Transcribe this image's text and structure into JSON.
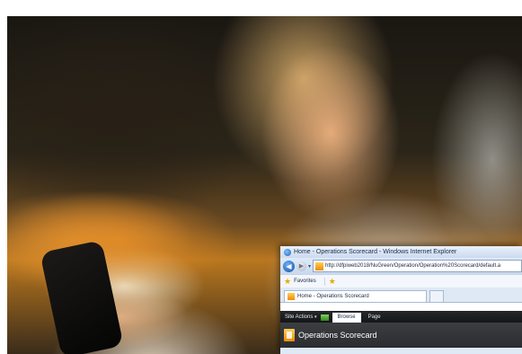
{
  "ie": {
    "window_title": "Home - Operations Scorecard - Windows Internet Explorer",
    "address_url": "http://dfpiweb2018/NuGreen/Operation/Operation%20Scorecard/default.a",
    "favorites_label": "Favorites",
    "tab_title": "Home - Operations Scorecard"
  },
  "sharepoint": {
    "site_actions_label": "Site Actions",
    "tab_browse": "Browse",
    "tab_page": "Page",
    "site_title": "Operations Scorecard"
  },
  "icons": {
    "back": "back-arrow-icon",
    "forward": "forward-arrow-icon",
    "favorites": "star-icon",
    "add_favorite": "add-favorites-icon",
    "page": "sharepoint-page-icon"
  }
}
